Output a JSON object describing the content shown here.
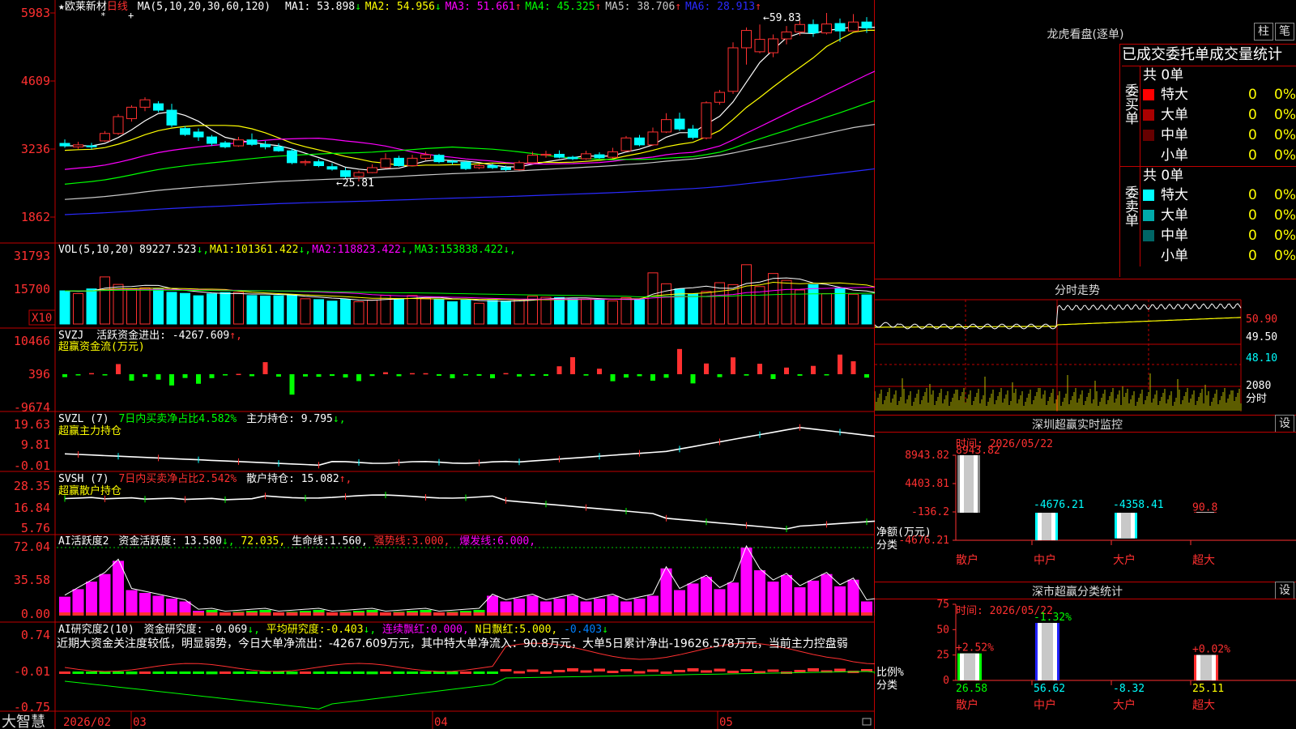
{
  "stock": {
    "name": "欧莱新材",
    "period": "日线",
    "markers": [
      "*",
      "+"
    ]
  },
  "price_panel": {
    "ma_label": "MA(5,10,20,30,60,120)",
    "ma_values": [
      {
        "label": "MA1:",
        "value": "53.898",
        "arrow": "↓",
        "color": "#ffffff"
      },
      {
        "label": "MA2:",
        "value": "54.956",
        "arrow": "↓",
        "color": "#ffff00"
      },
      {
        "label": "MA3:",
        "value": "51.661",
        "arrow": "↑",
        "color": "#ff00ff"
      },
      {
        "label": "MA4:",
        "value": "45.325",
        "arrow": "↑",
        "color": "#00ff00"
      },
      {
        "label": "MA5:",
        "value": "38.706",
        "arrow": "↑",
        "color": "#c8c8c8"
      },
      {
        "label": "MA6:",
        "value": "28.913",
        "arrow": "↑",
        "color": "#2a2aff"
      }
    ],
    "high_label": "59.83",
    "low_label": "25.81",
    "y_ticks": [
      "5983",
      "4609",
      "3236",
      "1862"
    ]
  },
  "vol_panel": {
    "label": "VOL(5,10,20)",
    "values": [
      {
        "value": "89227.523",
        "arrow": "↓",
        "color": "#ffffff",
        "label": ""
      },
      {
        "value": "101361.422",
        "arrow": "↓",
        "color": "#ffff00",
        "label": "MA1:"
      },
      {
        "value": "118823.422",
        "arrow": "↓",
        "color": "#ff00ff",
        "label": "MA2:"
      },
      {
        "value": "153838.422",
        "arrow": "↓",
        "color": "#00ff00",
        "label": "MA3:"
      }
    ],
    "y_ticks": [
      "31793",
      "15700"
    ],
    "unit": "X10"
  },
  "svzj_panel": {
    "label": "SVZJ",
    "desc": "活跃资金进出:",
    "value": "-4267.609",
    "arrow": "↑,",
    "subtitle": "超赢资金流(万元)",
    "y_ticks": [
      "10466",
      "396",
      "-9674"
    ]
  },
  "svzl_panel": {
    "label": "SVZL (7)",
    "desc1": "7日内买卖净占比4.582%",
    "desc2": "主力持仓:",
    "value": "9.795",
    "arrow": "↓,",
    "subtitle": "超赢主力持仓",
    "y_ticks": [
      "19.63",
      "9.81",
      "-0.01"
    ]
  },
  "svsh_panel": {
    "label": "SVSH (7)",
    "desc1": "7日内买卖净占比2.542%",
    "desc2": "散户持仓:",
    "value": "15.082",
    "arrow": "↑,",
    "subtitle": "超赢散户持仓",
    "y_ticks": [
      "28.35",
      "16.84",
      "5.76"
    ]
  },
  "ai_active_panel": {
    "label": "AI活跃度2",
    "desc": "资金活跃度:",
    "value": "13.580",
    "v2": "72.035,",
    "life_label": "生命线:",
    "life_value": "1.560,",
    "strong_label": "强势线:",
    "strong_value": "3.000,",
    "burst_label": "爆发线:",
    "burst_value": "6.000,",
    "y_ticks": [
      "72.04",
      "35.58",
      "0.00"
    ]
  },
  "ai_research_panel": {
    "label": "AI研究度2(10)",
    "desc": "资金研究度:",
    "value": "-0.069",
    "avg_label": "平均研究度:",
    "avg_value": "-0.403",
    "red_label": "连续飘红:",
    "red_value": "0.000,",
    "nday_label": "N日飘红:",
    "nday_value": "5.000,",
    "last_value": "-0.403",
    "comment": "近期大资金关注度较低，明显弱势，今日大单净流出：-4267.609万元，其中特大单净流入：90.8万元，大单5日累计净出-19626.578万元，当前主力控盘弱",
    "y_ticks": [
      "0.74",
      "-0.01",
      "-0.75"
    ]
  },
  "x_axis": {
    "labels": [
      "2026/02",
      "03",
      "04",
      "05"
    ]
  },
  "brand": "大智慧",
  "right": {
    "dragon_title": "龙虎看盘(逐单)",
    "btn_bar": "柱",
    "btn_note": "笔",
    "stat_title": "已成交委托单成交量统计",
    "buy": {
      "side": "委买单",
      "total": "共 0单",
      "rows": [
        {
          "label": "特大",
          "count": "0",
          "pct": "0%",
          "color": "#ff0000"
        },
        {
          "label": "大单",
          "count": "0",
          "pct": "0%",
          "color": "#aa0000"
        },
        {
          "label": "中单",
          "count": "0",
          "pct": "0%",
          "color": "#660000"
        },
        {
          "label": "小单",
          "count": "0",
          "pct": "0%",
          "color": "#000000"
        }
      ]
    },
    "sell": {
      "side": "委卖单",
      "total": "共 0单",
      "rows": [
        {
          "label": "特大",
          "count": "0",
          "pct": "0%",
          "color": "#00ffff"
        },
        {
          "label": "大单",
          "count": "0",
          "pct": "0%",
          "color": "#00aaaa"
        },
        {
          "label": "中单",
          "count": "0",
          "pct": "0%",
          "color": "#006666"
        },
        {
          "label": "小单",
          "count": "0",
          "pct": "0%",
          "color": "#000000"
        }
      ]
    },
    "intraday_title": "分时走势",
    "intraday_ticks": [
      "50.90",
      "49.50",
      "48.10",
      "2080"
    ],
    "intraday_unit": "分时",
    "sz_monitor": {
      "title": "深圳超赢实时监控",
      "btn": "设",
      "time": "时间: 2026/05/22",
      "y_ticks": [
        "8943.82",
        "4403.81",
        "-136.2",
        "-4676.21"
      ],
      "unit_line1": "净额(万元)",
      "unit_line2": "分类",
      "categories": [
        "散户",
        "中户",
        "大户",
        "超大"
      ],
      "values": [
        8943.82,
        -4676.21,
        -4358.41,
        90.8
      ],
      "value_labels": [
        "8943.82",
        "-4676.21",
        "-4358.41",
        "90.8"
      ]
    },
    "sz_classify": {
      "title": "深市超赢分类统计",
      "btn": "设",
      "time": "时间: 2026/05/22",
      "y_ticks": [
        "75",
        "50",
        "25",
        "0"
      ],
      "unit_line1": "比例%",
      "unit_line2": "分类",
      "categories": [
        "散户",
        "中户",
        "大户",
        "超大"
      ],
      "values": [
        26.58,
        56.62,
        -8.32,
        25.11
      ],
      "change_labels": [
        "+2.52%",
        "-1.32%",
        "",
        "+0.02%"
      ],
      "value_labels": [
        "26.58",
        "56.62",
        "-8.32",
        "25.11"
      ]
    }
  },
  "chart_data": [
    {
      "type": "candlestick",
      "title": "欧莱新材 日线",
      "ylim": [
        18.62,
        59.83
      ],
      "candles": [
        [
          33.5,
          33.0,
          34.3,
          32.6
        ],
        [
          32.8,
          33.2,
          33.8,
          32.4
        ],
        [
          33.0,
          32.8,
          33.6,
          32.3
        ],
        [
          34.0,
          35.5,
          36.0,
          33.8
        ],
        [
          35.5,
          38.9,
          39.4,
          35.2
        ],
        [
          38.5,
          40.8,
          41.2,
          37.9
        ],
        [
          40.8,
          42.3,
          42.8,
          40.0
        ],
        [
          41.5,
          40.2,
          42.0,
          39.8
        ],
        [
          40.2,
          37.2,
          41.5,
          36.8
        ],
        [
          36.5,
          35.3,
          37.0,
          35.0
        ],
        [
          35.8,
          34.8,
          36.5,
          34.0
        ],
        [
          34.8,
          33.5,
          35.2,
          33.0
        ],
        [
          33.6,
          32.8,
          34.0,
          32.5
        ],
        [
          33.0,
          34.2,
          34.8,
          32.8
        ],
        [
          34.2,
          33.3,
          35.5,
          33.0
        ],
        [
          33.3,
          32.8,
          34.0,
          32.3
        ],
        [
          32.8,
          32.0,
          33.5,
          31.8
        ],
        [
          32.0,
          29.6,
          32.5,
          29.3
        ],
        [
          29.6,
          29.8,
          30.2,
          29.0
        ],
        [
          29.8,
          29.0,
          30.3,
          28.7
        ],
        [
          28.8,
          28.3,
          29.5,
          28.0
        ],
        [
          28.0,
          26.8,
          28.6,
          26.5
        ],
        [
          26.8,
          27.6,
          28.0,
          25.81
        ],
        [
          27.6,
          28.6,
          29.3,
          27.5
        ],
        [
          28.6,
          30.4,
          31.5,
          28.4
        ],
        [
          30.5,
          29.0,
          31.0,
          28.8
        ],
        [
          29.0,
          30.5,
          31.2,
          28.9
        ],
        [
          30.5,
          31.2,
          31.8,
          30.1
        ],
        [
          31.1,
          29.8,
          31.4,
          29.5
        ],
        [
          29.9,
          29.7,
          30.2,
          29.2
        ],
        [
          29.7,
          28.4,
          30.0,
          28.1
        ],
        [
          28.6,
          29.0,
          29.4,
          28.3
        ],
        [
          29.0,
          28.6,
          29.4,
          28.3
        ],
        [
          28.6,
          28.2,
          29.0,
          27.9
        ],
        [
          28.2,
          29.6,
          30.0,
          28.0
        ],
        [
          29.6,
          31.1,
          31.8,
          29.4
        ],
        [
          31.1,
          31.3,
          32.0,
          30.6
        ],
        [
          31.3,
          30.7,
          32.1,
          30.5
        ],
        [
          30.7,
          30.4,
          31.0,
          30.1
        ],
        [
          30.4,
          31.4,
          32.0,
          30.2
        ],
        [
          31.2,
          30.6,
          31.7,
          30.4
        ],
        [
          30.7,
          31.8,
          32.6,
          30.5
        ],
        [
          32.0,
          34.6,
          35.0,
          31.8
        ],
        [
          34.6,
          33.2,
          35.2,
          32.9
        ],
        [
          33.2,
          35.8,
          36.7,
          33.0
        ],
        [
          35.8,
          38.3,
          39.6,
          35.6
        ],
        [
          38.4,
          36.4,
          39.7,
          36.0
        ],
        [
          36.4,
          34.7,
          37.2,
          34.3
        ],
        [
          34.6,
          41.7,
          42.0,
          34.3
        ],
        [
          41.8,
          43.8,
          44.3,
          41.3
        ],
        [
          44.0,
          52.8,
          53.9,
          43.5
        ],
        [
          52.8,
          56.3,
          56.9,
          49.4
        ],
        [
          52.0,
          54.5,
          57.5,
          51.7
        ],
        [
          51.8,
          54.6,
          55.5,
          50.9
        ],
        [
          54.6,
          56.0,
          57.2,
          53.5
        ],
        [
          56.0,
          57.5,
          58.3,
          55.3
        ],
        [
          57.5,
          55.8,
          58.5,
          55.0
        ],
        [
          55.8,
          57.6,
          59.83,
          55.5
        ],
        [
          57.7,
          56.2,
          58.7,
          54.0
        ],
        [
          56.2,
          58.0,
          59.6,
          56.4
        ],
        [
          58.0,
          56.8,
          59.0,
          55.8
        ],
        [
          57.0,
          56.3,
          57.9,
          55.7
        ],
        [
          56.5,
          57.4,
          58.5,
          55.2
        ],
        [
          57.3,
          58.5,
          59.2,
          56.5
        ],
        [
          58.5,
          57.4,
          58.8,
          56.5
        ],
        [
          57.3,
          52.5,
          58.0,
          52.3
        ],
        [
          52.8,
          53.9,
          55.0,
          52.6
        ]
      ]
    },
    {
      "type": "bar",
      "title": "VOL(5,10,20)",
      "ylim": [
        0,
        31793
      ],
      "values": [
        15500,
        14200,
        16400,
        22000,
        18500,
        16400,
        16900,
        16300,
        14800,
        14300,
        13200,
        14100,
        14700,
        14800,
        13300,
        13100,
        13200,
        13500,
        11800,
        11400,
        10700,
        11500,
        10400,
        11200,
        13400,
        11900,
        13300,
        12000,
        11600,
        10400,
        11200,
        9700,
        11000,
        10700,
        11300,
        13000,
        12500,
        12400,
        11700,
        11600,
        11200,
        10800,
        12300,
        11400,
        23900,
        18800,
        16400,
        14000,
        15200,
        19300,
        18400,
        27700,
        17500,
        23600,
        20400,
        15900,
        18400,
        14200,
        16900,
        13900,
        13600,
        13000,
        13600,
        15600,
        13100,
        12900,
        10600
      ]
    },
    {
      "type": "bar",
      "title": "超赢资金流(万元)",
      "ylim": [
        -9674,
        10466
      ],
      "values": [
        -850,
        -240,
        330,
        -340,
        2980,
        -1880,
        -780,
        -1600,
        -3300,
        -1100,
        -2800,
        -1150,
        -310,
        110,
        -580,
        3540,
        -700,
        -6000,
        -670,
        -750,
        -500,
        -960,
        -2010,
        -530,
        580,
        -580,
        320,
        300,
        -460,
        -1190,
        -240,
        -450,
        -1190,
        330,
        -650,
        -440,
        -470,
        2330,
        5000,
        -400,
        1620,
        -2050,
        -980,
        -580,
        -1900,
        -1030,
        7410,
        -2700,
        3150,
        -850,
        4950,
        -400,
        3070,
        -1410,
        1950,
        -450,
        2450,
        -270,
        5770,
        3800,
        -1000,
        -10400,
        -150,
        1900,
        -2400,
        2100,
        -2600
      ]
    }
  ]
}
